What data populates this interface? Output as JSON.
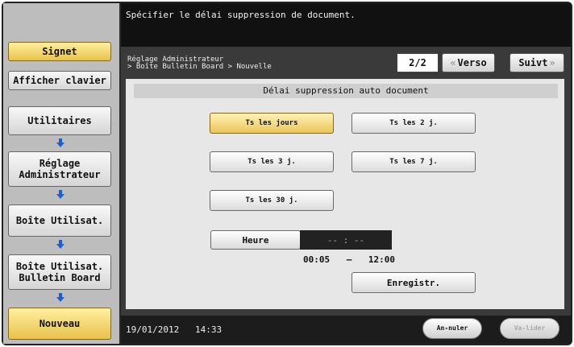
{
  "header": {
    "message": "Spécifier le délai suppression de document."
  },
  "sidebar": {
    "signet": "Signet",
    "afficher_clavier": "Afficher clavier",
    "utilitaires": "Utilitaires",
    "reglage_admin": "Réglage Administrateur",
    "boite_utilisat": "Boîte Utilisat.",
    "bulletin_board": "Boîte Utilisat. Bulletin Board",
    "nouveau": "Nouveau"
  },
  "nav": {
    "breadcrumb_line1": "Réglage Administrateur",
    "breadcrumb_line2": "> Boîte Bulletin Board > Nouvelle",
    "page": "2/2",
    "prev_label": "Verso",
    "next_label": "Suivt",
    "prev_icon": "double-left-arrow",
    "next_icon": "double-right-arrow"
  },
  "form": {
    "title": "Délai suppression auto document",
    "options": [
      {
        "label": "Ts les jours",
        "selected": true
      },
      {
        "label": "Ts les 2 j.",
        "selected": false
      },
      {
        "label": "Ts les 3 j.",
        "selected": false
      },
      {
        "label": "Ts les 7 j.",
        "selected": false
      },
      {
        "label": "Ts les 30 j.",
        "selected": false
      }
    ],
    "heure_label": "Heure",
    "heure_value": "-- : --",
    "range_start": "00:05",
    "range_sep": "–",
    "range_end": "12:00",
    "enregistr": "Enregistr."
  },
  "footer": {
    "date": "19/01/2012",
    "time": "14:33",
    "annuler": "An-nuler",
    "valider": "Va-lider"
  },
  "colors": {
    "selected": "#eac55a",
    "arrow": "#1b5fd6"
  }
}
